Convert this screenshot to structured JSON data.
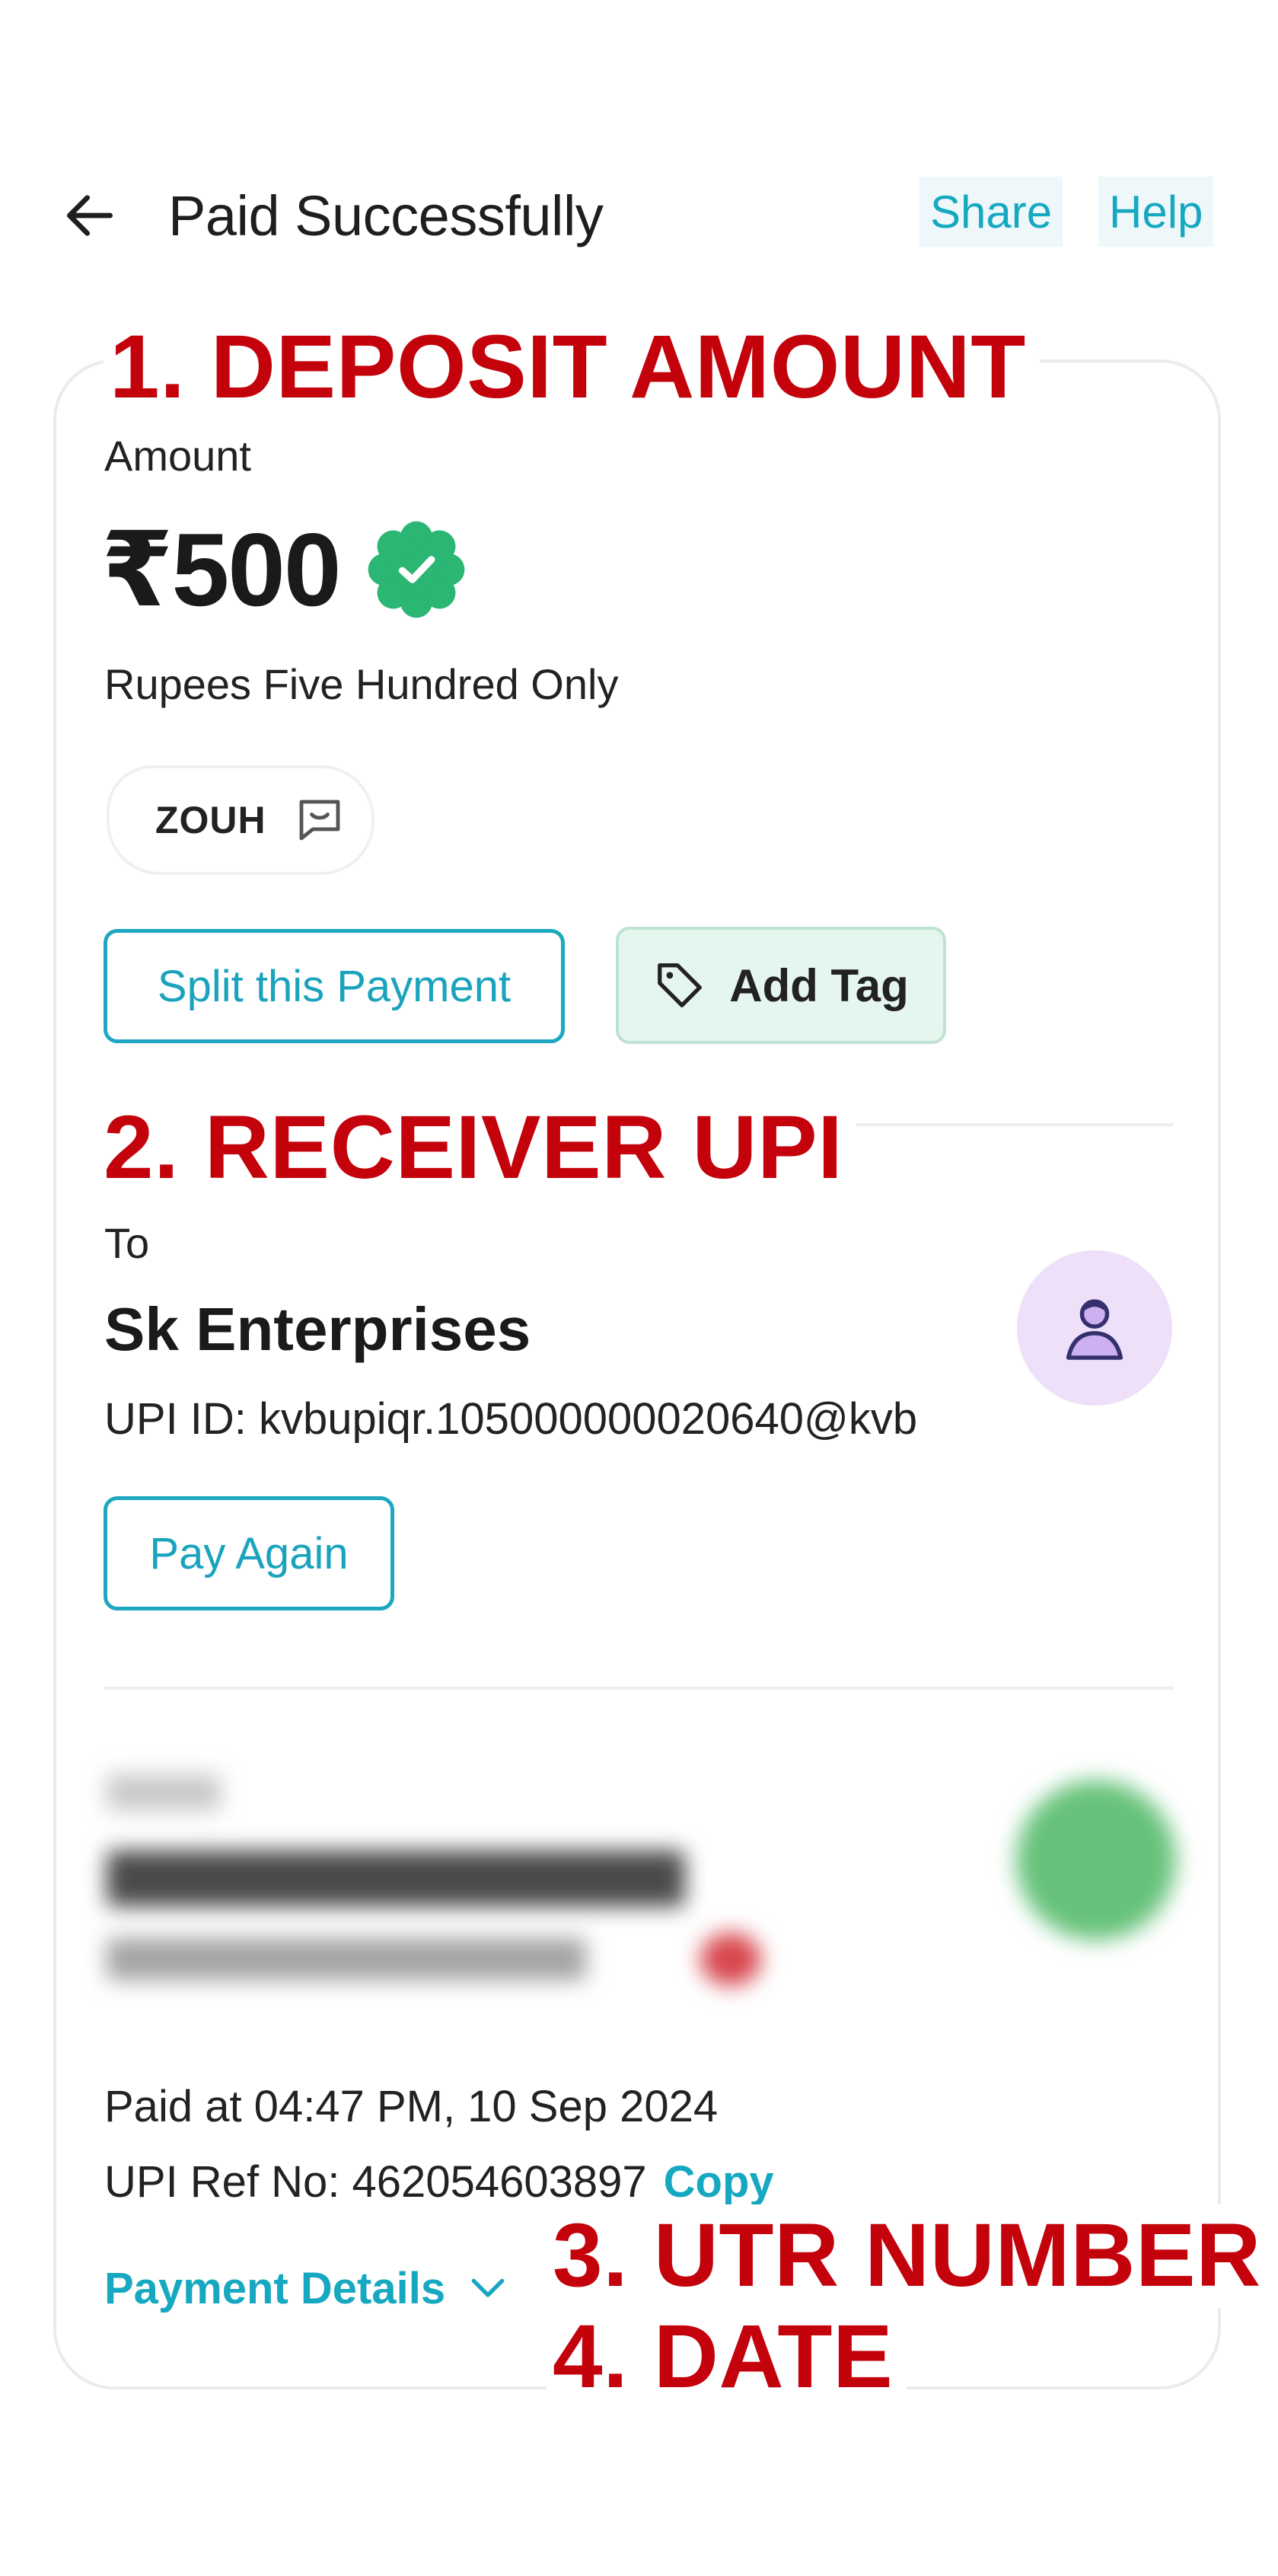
{
  "header": {
    "title": "Paid Successfully",
    "share_label": "Share",
    "help_label": "Help"
  },
  "annotations": {
    "deposit_amount": "1. DEPOSIT AMOUNT",
    "receiver_upi": "2. RECEIVER UPI",
    "utr_number": "3. UTR NUMBER",
    "date": "4. DATE"
  },
  "payment": {
    "amount_label": "Amount",
    "amount": "₹500",
    "amount_words": "Rupees Five Hundred Only",
    "note": "ZOUH",
    "split_label": "Split this Payment",
    "add_tag_label": "Add Tag"
  },
  "receiver": {
    "to_label": "To",
    "name": "Sk Enterprises",
    "upi_id": "UPI ID: kvbupiqr.105000000020640@kvb",
    "pay_again_label": "Pay Again"
  },
  "transaction": {
    "paid_at": "Paid at 04:47 PM, 10 Sep 2024",
    "upi_ref": "UPI Ref No: 462054603897",
    "copy_label": "Copy",
    "details_label": "Payment Details"
  },
  "colors": {
    "accent": "#16a8c0",
    "annotation_red": "#c3020b",
    "verified_green": "#2bb673",
    "tag_bg": "#e5f6ee",
    "avatar_bg": "#efe0fa"
  },
  "icons": [
    "back-arrow-icon",
    "verified-badge-icon",
    "message-icon",
    "tag-icon",
    "person-icon",
    "chevron-down-icon"
  ]
}
